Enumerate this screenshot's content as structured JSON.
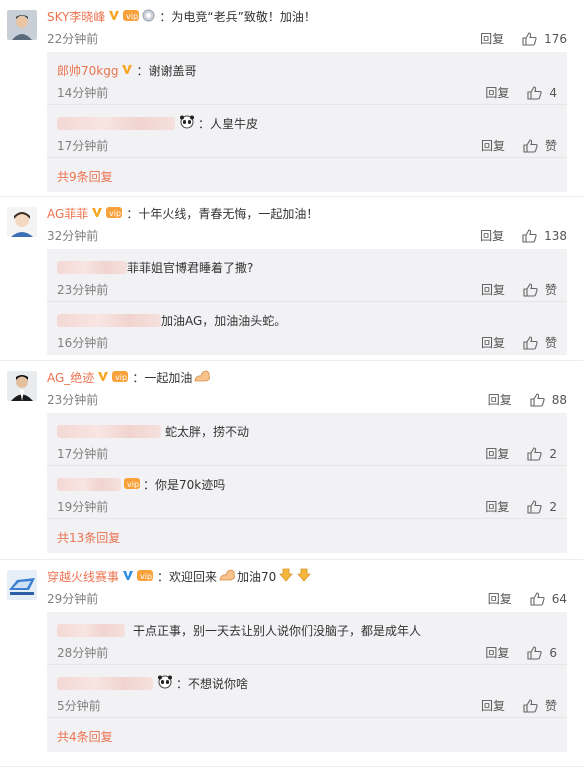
{
  "ui": {
    "reply_label": "回复",
    "like_label_empty": "赞"
  },
  "comments": [
    {
      "user": "SKY李晓峰",
      "text": "为电竞“老兵”致敬！加油！",
      "time": "22分钟前",
      "likes": "176",
      "replies": [
        {
          "user": "郎帅70kgg",
          "text": "谢谢盖哥",
          "time": "14分钟前",
          "likes": "4"
        },
        {
          "user": "",
          "text": "人皇牛皮",
          "time": "17分钟前",
          "likes": "赞"
        }
      ],
      "more": "共9条回复"
    },
    {
      "user": "AG菲菲",
      "text": "十年火线，青春无悔，一起加油！",
      "time": "32分钟前",
      "likes": "138",
      "replies": [
        {
          "user": "",
          "text": "菲菲姐官博君睡着了撒?",
          "time": "23分钟前",
          "likes": "赞"
        },
        {
          "user": "",
          "text": "加油AG，加油油头蛇。",
          "time": "16分钟前",
          "likes": "赞"
        }
      ],
      "more": ""
    },
    {
      "user": "AG_绝迹",
      "text": "一起加油",
      "time": "23分钟前",
      "likes": "88",
      "replies": [
        {
          "user": "",
          "text": "蛇太胖，捞不动",
          "time": "17分钟前",
          "likes": "2"
        },
        {
          "user": "",
          "text": "你是70k迹吗",
          "time": "19分钟前",
          "likes": "2"
        }
      ],
      "more": "共13条回复"
    },
    {
      "user": "穿越火线赛事",
      "text": "欢迎回来",
      "text2": "加油70",
      "time": "29分钟前",
      "likes": "64",
      "replies": [
        {
          "user": "",
          "text": "干点正事，别一天去让别人说你们没脑子，都是成年人",
          "time": "28分钟前",
          "likes": "6"
        },
        {
          "user": "",
          "text": "不想说你啥",
          "time": "5分钟前",
          "likes": "赞"
        }
      ],
      "more": "共4条回复"
    }
  ]
}
